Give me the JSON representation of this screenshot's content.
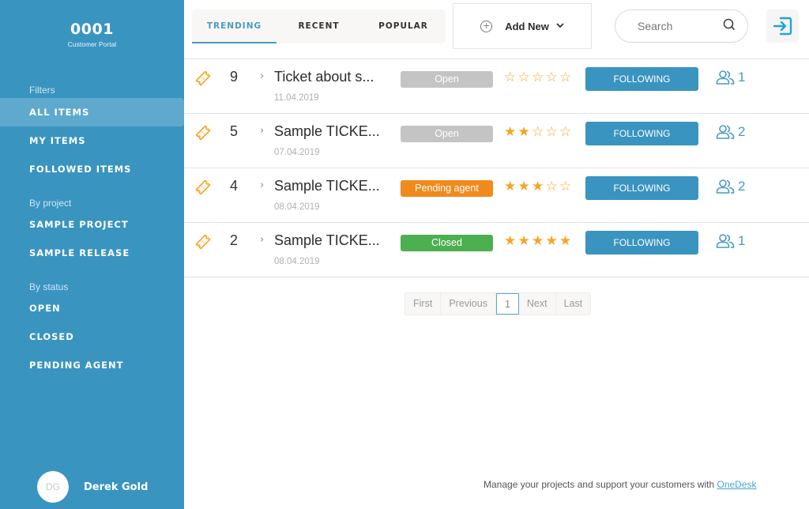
{
  "sidebar": {
    "brand_code": "0001",
    "brand_subtitle": "Customer Portal",
    "sections": {
      "filters": "Filters",
      "by_project": "By project",
      "by_status": "By status"
    },
    "filters": [
      {
        "label": "ALL ITEMS",
        "active": true
      },
      {
        "label": "MY ITEMS",
        "active": false
      },
      {
        "label": "FOLLOWED ITEMS",
        "active": false
      }
    ],
    "projects": [
      {
        "label": "SAMPLE PROJECT"
      },
      {
        "label": "SAMPLE RELEASE"
      }
    ],
    "statuses": [
      {
        "label": "OPEN"
      },
      {
        "label": "CLOSED"
      },
      {
        "label": "PENDING AGENT"
      }
    ],
    "user": {
      "initials": "DG",
      "name": "Derek Gold"
    }
  },
  "header": {
    "tabs": [
      {
        "label": "TRENDING",
        "active": true
      },
      {
        "label": "RECENT",
        "active": false
      },
      {
        "label": "POPULAR",
        "active": false
      }
    ],
    "add_new": {
      "label": "Add New",
      "icon": "plus-circle-icon",
      "dropdown_icon": "chevron-down-icon"
    },
    "search": {
      "placeholder": "Search",
      "value": "",
      "icon": "search-icon"
    },
    "login_icon": "sign-in-icon"
  },
  "colors": {
    "brand": "#3a94c0",
    "accent": "#4a9ac4",
    "star": "#f5a623",
    "ticket_icon": "#f5a623",
    "status_open": "#c4c4c4",
    "status_pending": "#f08a1c",
    "status_closed": "#4caf50"
  },
  "tickets": [
    {
      "id": "9",
      "title": "Ticket about s...",
      "date": "11.04.2019",
      "status": "Open",
      "status_color": "#c4c4c4",
      "rating": 0,
      "max_rating": 5,
      "follow_label": "FOLLOWING",
      "followers": "1"
    },
    {
      "id": "5",
      "title": "Sample TICKE...",
      "date": "07.04.2019",
      "status": "Open",
      "status_color": "#c4c4c4",
      "rating": 2,
      "max_rating": 5,
      "follow_label": "FOLLOWING",
      "followers": "2"
    },
    {
      "id": "4",
      "title": "Sample TICKE...",
      "date": "08.04.2019",
      "status": "Pending agent",
      "status_color": "#f08a1c",
      "rating": 3,
      "max_rating": 5,
      "follow_label": "FOLLOWING",
      "followers": "2"
    },
    {
      "id": "2",
      "title": "Sample TICKE...",
      "date": "08.04.2019",
      "status": "Closed",
      "status_color": "#4caf50",
      "rating": 5,
      "max_rating": 5,
      "follow_label": "FOLLOWING",
      "followers": "1"
    }
  ],
  "pagination": {
    "first": "First",
    "previous": "Previous",
    "current": "1",
    "next": "Next",
    "last": "Last"
  },
  "footer": {
    "text": "Manage your projects and support your customers with ",
    "link_text": "OneDesk"
  }
}
